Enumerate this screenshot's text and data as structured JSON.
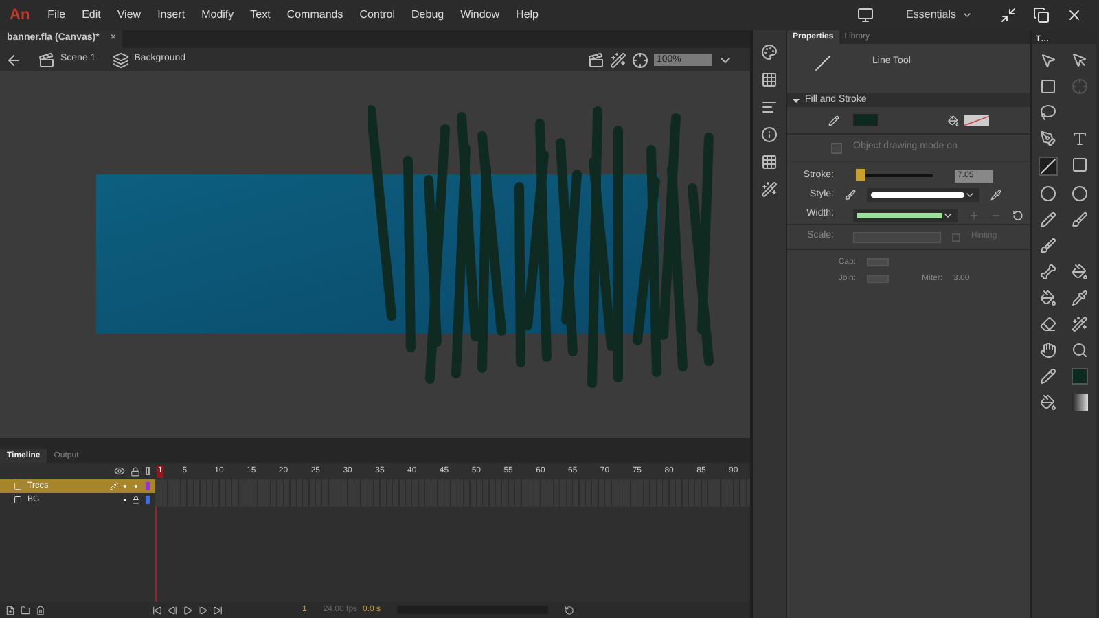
{
  "menu_bar": {
    "app_logo": "An",
    "items": [
      "File",
      "Edit",
      "View",
      "Insert",
      "Modify",
      "Text",
      "Commands",
      "Control",
      "Debug",
      "Window",
      "Help"
    ],
    "workspace": "Essentials"
  },
  "document_tab": {
    "title": "banner.fla (Canvas)*",
    "close": "×"
  },
  "edit_bar": {
    "breadcrumbs": [
      "Scene 1",
      "Background"
    ],
    "zoom": "100%"
  },
  "properties": {
    "tabs": [
      {
        "label": "Properties",
        "selected": true
      },
      {
        "label": "Library",
        "selected": false
      }
    ],
    "tool_name": "Line Tool",
    "section": {
      "title": "Fill and Stroke",
      "expanded": true
    },
    "object_drawing": {
      "label": "Object drawing mode on",
      "checked": false,
      "disabled": true
    },
    "stroke": {
      "label": "Stroke:",
      "level": 0.06,
      "value": "7.05"
    },
    "style": {
      "label": "Style:"
    },
    "width": {
      "label": "Width:"
    },
    "scale": {
      "label": "Scale:"
    },
    "hinting": {
      "label": "Hinting",
      "checked": false
    },
    "cap": {
      "label": "Cap:"
    },
    "join": {
      "label": "Join:"
    },
    "miter": {
      "label": "Miter:",
      "value": "3.00"
    }
  },
  "toolbar": {
    "title": "T…"
  },
  "timeline": {
    "tabs": [
      {
        "label": "Timeline",
        "selected": true
      },
      {
        "label": "Output",
        "selected": false
      }
    ],
    "frame_numbers": [
      "1",
      "5",
      "10",
      "15",
      "20",
      "25",
      "30",
      "35",
      "40",
      "45",
      "50",
      "55",
      "60",
      "65",
      "70",
      "75",
      "80",
      "85",
      "90"
    ],
    "layers": [
      {
        "name": "Trees",
        "selected": true,
        "locked": false,
        "color": "#9b30e0"
      },
      {
        "name": "BG",
        "selected": false,
        "locked": true,
        "color": "#3b6ee0"
      }
    ],
    "current_frame": "1",
    "fps": "24.00 fps",
    "time": "0.0 s"
  }
}
